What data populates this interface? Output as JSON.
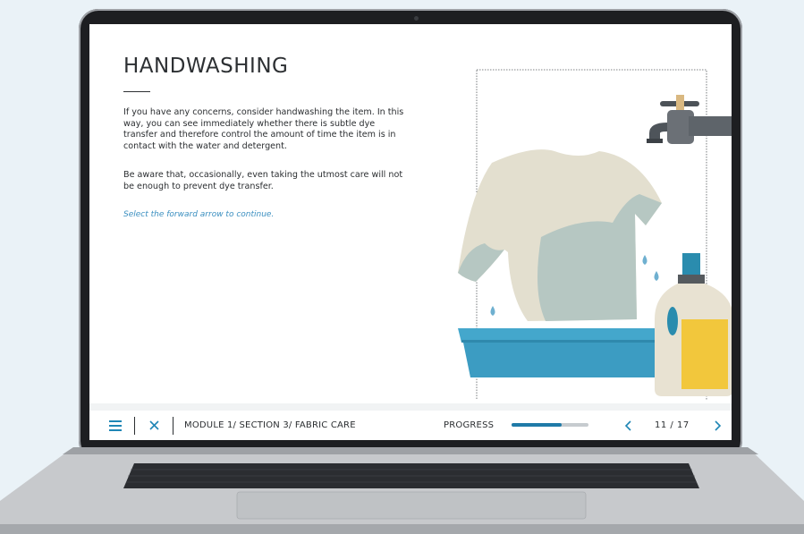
{
  "slide": {
    "title": "HANDWASHING",
    "paragraphs": [
      "If you have any concerns, consider handwashing the item. In this way, you can see immediately whether there is subtle dye transfer and therefore control the amount of time the item is in contact with the water and detergent.",
      "Be aware that, occasionally, even taking the utmost care will not be enough to prevent dye transfer."
    ],
    "hint": "Select the forward arrow to continue."
  },
  "illustration": {
    "icons": [
      "faucet-icon",
      "tshirt-icon",
      "water-drop-icon",
      "wash-basin-icon",
      "detergent-bottle-icon"
    ]
  },
  "navbar": {
    "menu_icon": "hamburger-icon",
    "close_icon": "close-icon",
    "breadcrumb": "MODULE 1/ SECTION 3/ FABRIC CARE",
    "progress_label": "PROGRESS",
    "progress_fraction": 0.65,
    "page_counter": "11 / 17",
    "prev_icon": "chevron-left-icon",
    "next_icon": "chevron-right-icon"
  },
  "colors": {
    "accent": "#1f86b5",
    "progress_fill": "#1f7aa8",
    "hint_text": "#3b8fc0",
    "basin": "#3ea1c6",
    "tshirt": "#e2dfd0",
    "detergent": "#f2c73c"
  }
}
